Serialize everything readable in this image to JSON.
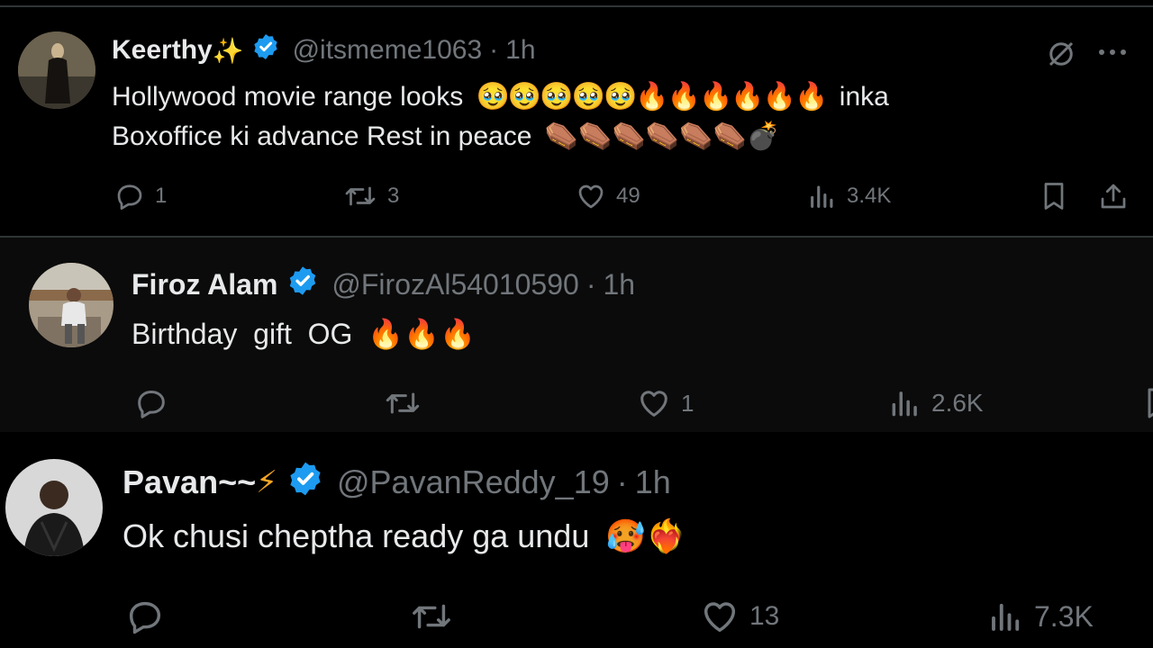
{
  "tweets": [
    {
      "name": "Keerthy",
      "name_emoji": "✨",
      "handle": "@itsmeme1063",
      "separator": "·",
      "time": "1h",
      "text_line1": "Hollywood movie range looks",
      "emoji_line1": "🥹🥹🥹🥹🥹🔥🔥🔥🔥🔥🔥",
      "text_line1_tail": "inka",
      "text_line2": "Boxoffice ki advance Rest in peace",
      "emoji_line2": "⚰️⚰️⚰️⚰️⚰️⚰️💣",
      "replies": "1",
      "reposts": "3",
      "likes": "49",
      "views": "3.4K"
    },
    {
      "name": "Firoz Alam",
      "handle": "@FirozAl54010590",
      "separator": "·",
      "time": "1h",
      "text": "Birthday  gift  OG",
      "emoji": "🔥🔥🔥",
      "replies": "",
      "reposts": "",
      "likes": "1",
      "views": "2.6K"
    },
    {
      "name": "Pavan~~",
      "name_emoji": "⚡",
      "handle": "@PavanReddy_19",
      "separator": "·",
      "time": "1h",
      "text": "Ok chusi cheptha ready ga undu",
      "emoji": "🥵❤️‍🔥",
      "replies": "",
      "reposts": "",
      "likes": "13",
      "views": "7.3K"
    }
  ],
  "colors": {
    "background": "#000000",
    "text": "#e7e9ea",
    "muted": "#71767b",
    "verified": "#1d9bf0",
    "divider": "#2f3336"
  },
  "icons": [
    "verified-badge-icon",
    "grok-icon",
    "more-icon",
    "reply-icon",
    "repost-icon",
    "like-icon",
    "views-icon",
    "bookmark-icon",
    "share-icon"
  ]
}
